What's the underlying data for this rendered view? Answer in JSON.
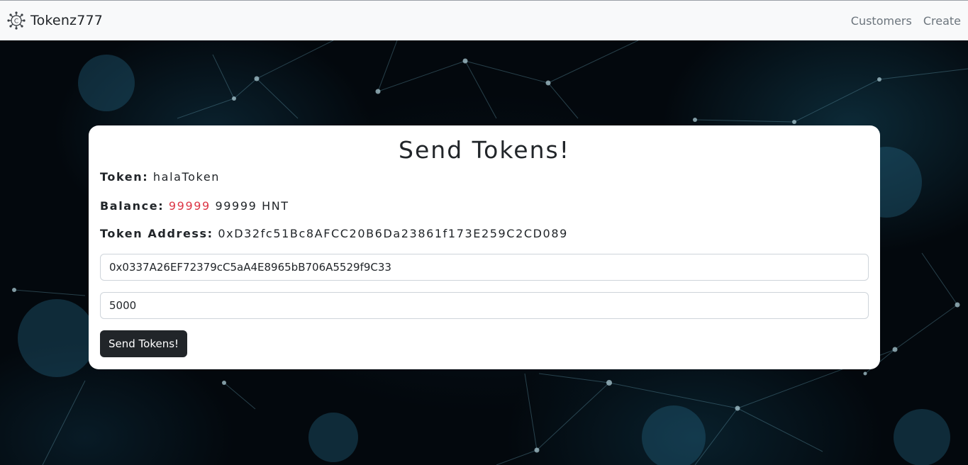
{
  "navbar": {
    "brand": "Tokenz777",
    "logo_icon": "token-network-icon",
    "links": [
      "Customers",
      "Create"
    ]
  },
  "card": {
    "title": "Send Tokens!",
    "token_label": "Token:",
    "token_value": "halaToken",
    "balance_label": "Balance:",
    "balance_value_red": "99999",
    "balance_value": "99999 HNT",
    "address_label": "Token Address:",
    "address_value": "0xD32fc51Bc8AFCC20B6Da23861f173E259C2CD089",
    "recipient_input_value": "0x0337A26EF72379cC5aA4E8965bB706A5529f9C33",
    "amount_input_value": "5000",
    "send_button": "Send Tokens!"
  },
  "colors": {
    "navbar_bg": "#f8f9fa",
    "accent_red": "#dc3545",
    "button_bg": "#212529",
    "background": "#03080d"
  }
}
